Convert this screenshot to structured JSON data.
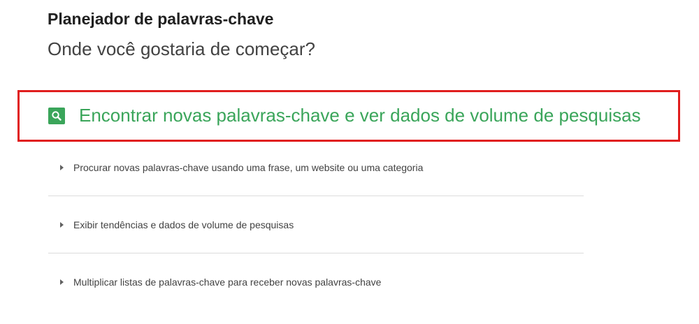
{
  "header": {
    "title": "Planejador de palavras-chave",
    "subtitle": "Onde você gostaria de começar?"
  },
  "main_option": {
    "label": "Encontrar novas palavras-chave e ver dados de volume de pesquisas",
    "icon": "search-icon"
  },
  "options": [
    {
      "label": "Procurar novas palavras-chave usando uma frase, um website ou uma categoria",
      "icon": "triangle-right-icon"
    },
    {
      "label": "Exibir tendências e dados de volume de pesquisas",
      "icon": "triangle-right-icon"
    },
    {
      "label": "Multiplicar listas de palavras-chave para receber novas palavras-chave",
      "icon": "triangle-right-icon"
    }
  ],
  "colors": {
    "accent_green": "#3aa55a",
    "highlight_red": "#e01e1e"
  }
}
